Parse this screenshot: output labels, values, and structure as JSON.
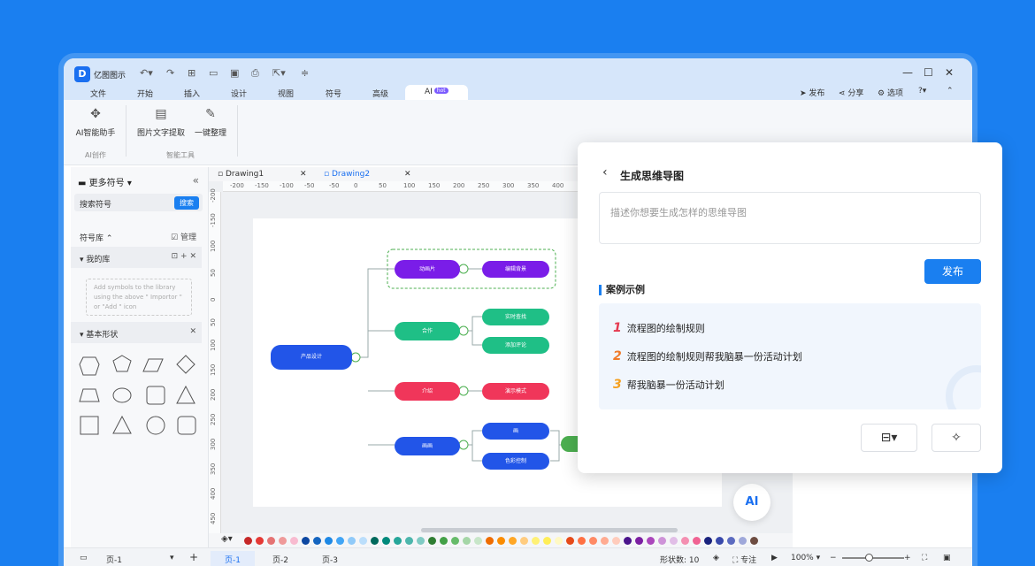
{
  "app": {
    "name": "亿图图示"
  },
  "menu": {
    "items": [
      "文件",
      "开始",
      "插入",
      "设计",
      "视图",
      "符号",
      "高级"
    ],
    "ai_tab": "AI",
    "ai_badge": "hot"
  },
  "topright": {
    "publish": "发布",
    "share": "分享",
    "options": "选项",
    "help": "?"
  },
  "ribbon": {
    "ai_assistant": "AI智能助手",
    "ocr": "图片文字提取",
    "tidy": "一键整理",
    "group_ai": "AI创作",
    "group_tools": "智能工具"
  },
  "sidebar": {
    "title": "更多符号",
    "search_placeholder": "搜索符号",
    "search_button": "搜索",
    "library_label": "符号库",
    "manage_label": "管理",
    "mylib_label": "我的库",
    "empty_hint": "Add symbols to the library using the above \" Importor \" or \"Add \" icon",
    "basic_shapes_label": "基本形状"
  },
  "tabs": [
    "Drawing1",
    "Drawing2"
  ],
  "ruler_h": [
    "-200",
    "-150",
    "-100",
    "-50",
    "-50",
    "0",
    "50",
    "100",
    "150",
    "200",
    "250",
    "300",
    "350",
    "400"
  ],
  "ruler_v": [
    "-200",
    "-150",
    "100",
    "50",
    "0",
    "50",
    "100",
    "150",
    "200",
    "250",
    "300",
    "350",
    "400",
    "450"
  ],
  "mindmap": {
    "root": "产品设计",
    "b1": "动画片",
    "b1c1": "编辑背景",
    "b2": "合作",
    "b2c1": "实时查找",
    "b2c2": "添加评论",
    "b3": "介绍",
    "b3c1": "演示模式",
    "b4": "画画",
    "b4c1": "画",
    "b4c2": "色彩控制"
  },
  "colors": [
    "#c62828",
    "#e53935",
    "#e57373",
    "#ef9a9a",
    "#f8bbd0",
    "#0d47a1",
    "#1565c0",
    "#1e88e5",
    "#42a5f5",
    "#90caf9",
    "#bbdefb",
    "#00695c",
    "#00897b",
    "#26a69a",
    "#4db6ac",
    "#80cbc4",
    "#2e7d32",
    "#43a047",
    "#66bb6a",
    "#a5d6a7",
    "#c8e6c9",
    "#ef6c00",
    "#fb8c00",
    "#ffa726",
    "#ffcc80",
    "#fff176",
    "#ffee58",
    "#fff9c4",
    "#e64a19",
    "#ff7043",
    "#ff8a65",
    "#ffab91",
    "#ffccbc",
    "#4a148c",
    "#7b1fa2",
    "#ab47bc",
    "#ce93d8",
    "#e1bee7",
    "#f48fb1",
    "#f06292",
    "#1a237e",
    "#3949ab",
    "#5c6bc0",
    "#9fa8da",
    "#6d4c41"
  ],
  "status": {
    "page_selector": "页-1",
    "pages": [
      "页-1",
      "页-2",
      "页-3"
    ],
    "shape_count_label": "形状数:",
    "shape_count": "10",
    "focus_label": "专注",
    "zoom": "100%"
  },
  "panel": {
    "title": "生成思维导图",
    "prompt_placeholder": "描述你想要生成怎样的思维导图",
    "publish": "发布",
    "examples_title": "案例示例",
    "examples": [
      {
        "num": "1",
        "text": "流程图的绘制规则"
      },
      {
        "num": "2",
        "text": "流程图的绘制规则帮我脑暴一份活动计划"
      },
      {
        "num": "3",
        "text": "帮我脑暴一份活动计划"
      }
    ]
  },
  "ai_badge_text": "AI"
}
